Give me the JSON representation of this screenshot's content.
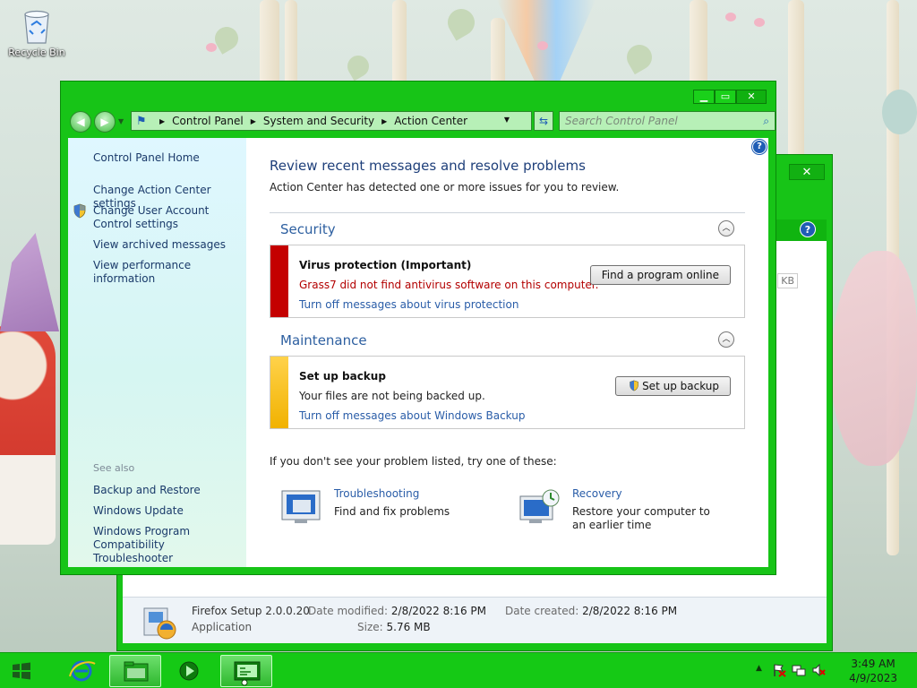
{
  "desktop": {
    "recycle_bin_label": "Recycle Bin"
  },
  "background_window": {
    "size_badge": "KB",
    "details": {
      "file_name": "Firefox Setup 2.0.0.20",
      "file_type": "Application",
      "date_modified_label": "Date modified:",
      "date_modified": "2/8/2022 8:16 PM",
      "date_created_label": "Date created:",
      "date_created": "2/8/2022 8:16 PM",
      "size_label": "Size:",
      "size": "5.76 MB"
    }
  },
  "window": {
    "breadcrumbs": [
      "Control Panel",
      "System and Security",
      "Action Center"
    ],
    "search_placeholder": "Search Control Panel",
    "left_pane": {
      "home": "Control Panel Home",
      "links": [
        "Change Action Center settings",
        "Change User Account Control settings",
        "View archived messages",
        "View performance information"
      ],
      "see_also_label": "See also",
      "see_also": [
        "Backup and Restore",
        "Windows Update",
        "Windows Program Compatibility Troubleshooter"
      ]
    },
    "main": {
      "title": "Review recent messages and resolve problems",
      "subtitle": "Action Center has detected one or more issues for you to review.",
      "security": {
        "heading": "Security",
        "alert_title": "Virus protection  (Important)",
        "alert_desc": "Grass7 did not find antivirus software on this computer.",
        "alert_link": "Turn off messages about virus protection",
        "button": "Find a program online"
      },
      "maintenance": {
        "heading": "Maintenance",
        "alert_title": "Set up backup",
        "alert_desc": "Your files are not being backed up.",
        "alert_link": "Turn off messages about Windows Backup",
        "button": "Set up backup"
      },
      "try_text": "If you don't see your problem listed, try one of these:",
      "tools": [
        {
          "link": "Troubleshooting",
          "desc": "Find and fix problems"
        },
        {
          "link": "Recovery",
          "desc": "Restore your computer to an earlier time"
        }
      ]
    }
  },
  "taskbar": {
    "time": "3:49 AM",
    "date": "4/9/2023"
  },
  "colors": {
    "window_frame": "#17c417",
    "taskbar": "#15c915",
    "security_bar": "#c40000",
    "maintenance_bar": "#f1b200",
    "link": "#2a5da8"
  }
}
